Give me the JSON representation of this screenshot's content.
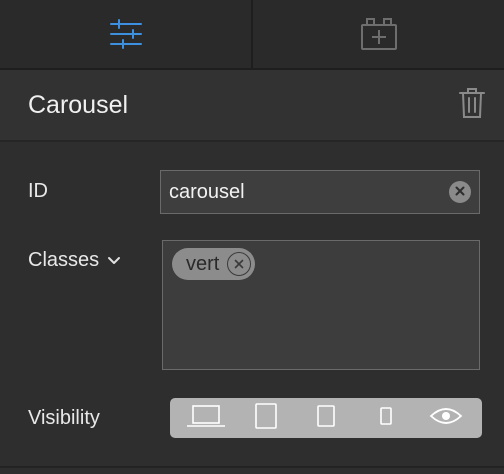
{
  "tabs": [
    {
      "icon": "sliders-icon",
      "active": true,
      "color": "#3d8fe0"
    },
    {
      "icon": "add-component-icon",
      "active": false,
      "color": "#6e6e6e"
    }
  ],
  "header": {
    "title": "Carousel",
    "delete_icon": "trash-icon"
  },
  "fields": {
    "id": {
      "label": "ID",
      "value": "carousel",
      "clear_icon": "clear-icon"
    },
    "classes": {
      "label": "Classes",
      "chevron_icon": "chevron-down-icon",
      "items": [
        {
          "label": "vert",
          "remove_icon": "remove-icon"
        }
      ]
    },
    "visibility": {
      "label": "Visibility",
      "devices": [
        {
          "name": "desktop",
          "icon": "laptop-icon"
        },
        {
          "name": "tablet",
          "icon": "tablet-icon"
        },
        {
          "name": "tablet-small",
          "icon": "tablet-small-icon"
        },
        {
          "name": "phone",
          "icon": "phone-icon"
        },
        {
          "name": "preview",
          "icon": "eye-icon"
        }
      ]
    }
  }
}
